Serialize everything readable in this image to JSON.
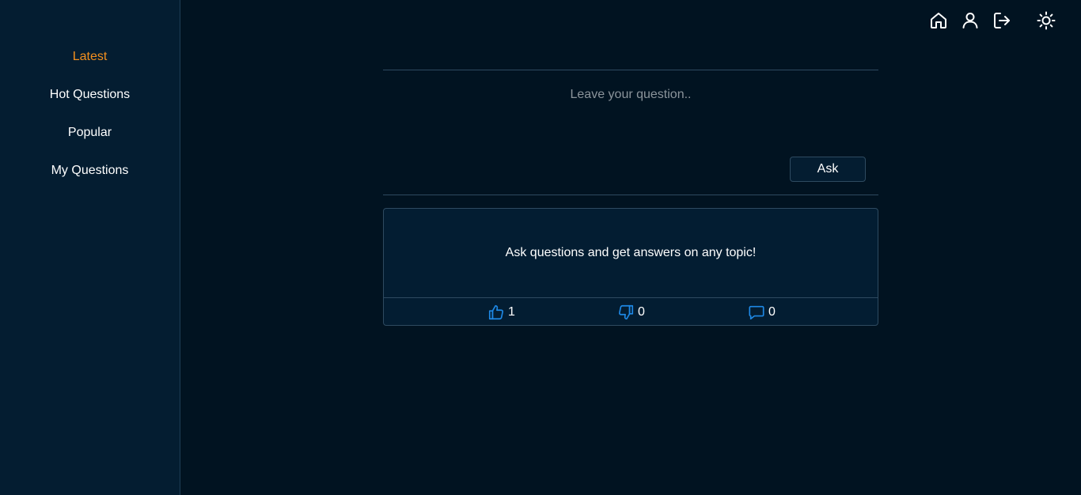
{
  "sidebar": {
    "items": [
      {
        "label": "Latest",
        "active": true
      },
      {
        "label": "Hot Questions",
        "active": false
      },
      {
        "label": "Popular",
        "active": false
      },
      {
        "label": "My Questions",
        "active": false
      }
    ]
  },
  "topbar": {
    "icons": [
      "home-icon",
      "user-icon",
      "logout-icon",
      "sun-icon"
    ]
  },
  "composer": {
    "placeholder": "Leave your question..",
    "value": "",
    "ask_label": "Ask"
  },
  "question": {
    "text": "Ask questions and get answers on any topic!",
    "likes": "1",
    "dislikes": "0",
    "comments": "0"
  },
  "colors": {
    "background": "#011321",
    "sidebar": "#041d31",
    "accent_active": "#f4901e",
    "icon_blue": "#1e88e5",
    "border": "#2e4a60"
  }
}
